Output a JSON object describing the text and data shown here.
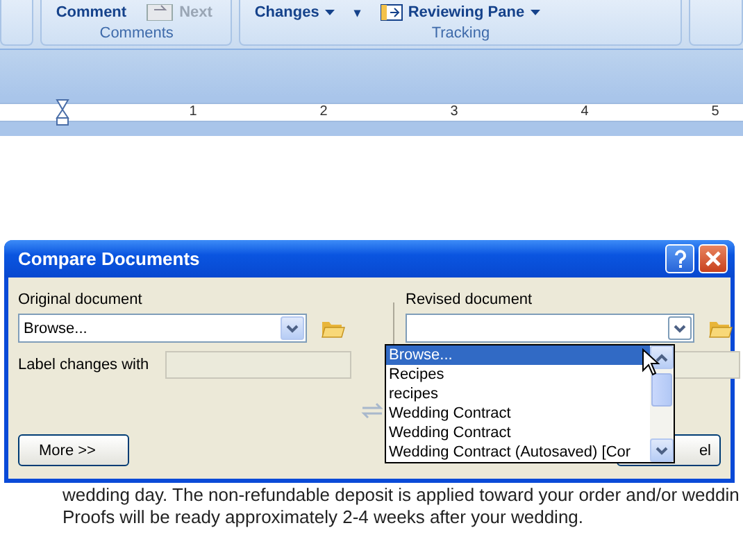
{
  "ribbon": {
    "groups": [
      {
        "label": "Comments",
        "buttons": [
          {
            "label": "Comment",
            "kind": "text",
            "disabled": false
          },
          {
            "label": "Next",
            "kind": "icon-text",
            "disabled": true
          }
        ]
      },
      {
        "label": "Tracking",
        "buttons": [
          {
            "label": "Changes",
            "kind": "dropdown",
            "disabled": false
          },
          {
            "label": "▾",
            "kind": "caret",
            "disabled": false
          },
          {
            "label": "Reviewing Pane",
            "kind": "icon-dropdown",
            "disabled": false
          }
        ]
      }
    ]
  },
  "ruler": {
    "numbers": [
      "1",
      "2",
      "3",
      "4",
      "5"
    ]
  },
  "document": {
    "lines": [
      "wedding day. The non-refundable deposit is applied toward your order and/or weddin",
      "Proofs will be ready approximately 2-4 weeks after your wedding."
    ]
  },
  "dialog": {
    "title": "Compare Documents",
    "original": {
      "label": "Original document",
      "value": "Browse...",
      "label_changes": "Label changes with"
    },
    "revised": {
      "label": "Revised document",
      "list": [
        {
          "text": "Browse...",
          "selected": true
        },
        {
          "text": "Recipes",
          "selected": false
        },
        {
          "text": "recipes",
          "selected": false
        },
        {
          "text": "Wedding Contract",
          "selected": false
        },
        {
          "text": "Wedding Contract",
          "selected": false
        },
        {
          "text": "Wedding Contract (Autosaved) [Cor",
          "selected": false
        }
      ]
    },
    "more_button": "More >>",
    "cancel_button_visible": "el"
  }
}
